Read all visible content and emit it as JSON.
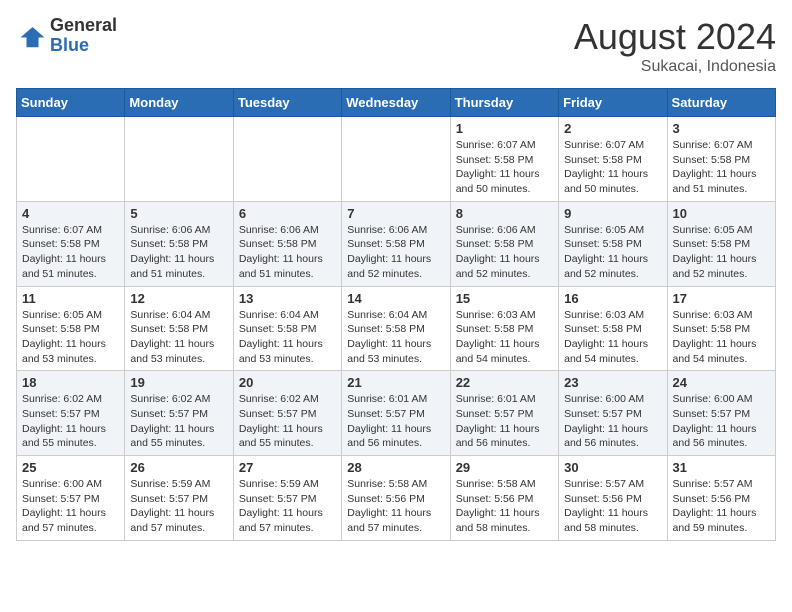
{
  "logo": {
    "general": "General",
    "blue": "Blue"
  },
  "title": {
    "month_year": "August 2024",
    "location": "Sukacai, Indonesia"
  },
  "weekdays": [
    "Sunday",
    "Monday",
    "Tuesday",
    "Wednesday",
    "Thursday",
    "Friday",
    "Saturday"
  ],
  "weeks": [
    [
      {
        "day": "",
        "info": ""
      },
      {
        "day": "",
        "info": ""
      },
      {
        "day": "",
        "info": ""
      },
      {
        "day": "",
        "info": ""
      },
      {
        "day": "1",
        "info": "Sunrise: 6:07 AM\nSunset: 5:58 PM\nDaylight: 11 hours\nand 50 minutes."
      },
      {
        "day": "2",
        "info": "Sunrise: 6:07 AM\nSunset: 5:58 PM\nDaylight: 11 hours\nand 50 minutes."
      },
      {
        "day": "3",
        "info": "Sunrise: 6:07 AM\nSunset: 5:58 PM\nDaylight: 11 hours\nand 51 minutes."
      }
    ],
    [
      {
        "day": "4",
        "info": "Sunrise: 6:07 AM\nSunset: 5:58 PM\nDaylight: 11 hours\nand 51 minutes."
      },
      {
        "day": "5",
        "info": "Sunrise: 6:06 AM\nSunset: 5:58 PM\nDaylight: 11 hours\nand 51 minutes."
      },
      {
        "day": "6",
        "info": "Sunrise: 6:06 AM\nSunset: 5:58 PM\nDaylight: 11 hours\nand 51 minutes."
      },
      {
        "day": "7",
        "info": "Sunrise: 6:06 AM\nSunset: 5:58 PM\nDaylight: 11 hours\nand 52 minutes."
      },
      {
        "day": "8",
        "info": "Sunrise: 6:06 AM\nSunset: 5:58 PM\nDaylight: 11 hours\nand 52 minutes."
      },
      {
        "day": "9",
        "info": "Sunrise: 6:05 AM\nSunset: 5:58 PM\nDaylight: 11 hours\nand 52 minutes."
      },
      {
        "day": "10",
        "info": "Sunrise: 6:05 AM\nSunset: 5:58 PM\nDaylight: 11 hours\nand 52 minutes."
      }
    ],
    [
      {
        "day": "11",
        "info": "Sunrise: 6:05 AM\nSunset: 5:58 PM\nDaylight: 11 hours\nand 53 minutes."
      },
      {
        "day": "12",
        "info": "Sunrise: 6:04 AM\nSunset: 5:58 PM\nDaylight: 11 hours\nand 53 minutes."
      },
      {
        "day": "13",
        "info": "Sunrise: 6:04 AM\nSunset: 5:58 PM\nDaylight: 11 hours\nand 53 minutes."
      },
      {
        "day": "14",
        "info": "Sunrise: 6:04 AM\nSunset: 5:58 PM\nDaylight: 11 hours\nand 53 minutes."
      },
      {
        "day": "15",
        "info": "Sunrise: 6:03 AM\nSunset: 5:58 PM\nDaylight: 11 hours\nand 54 minutes."
      },
      {
        "day": "16",
        "info": "Sunrise: 6:03 AM\nSunset: 5:58 PM\nDaylight: 11 hours\nand 54 minutes."
      },
      {
        "day": "17",
        "info": "Sunrise: 6:03 AM\nSunset: 5:58 PM\nDaylight: 11 hours\nand 54 minutes."
      }
    ],
    [
      {
        "day": "18",
        "info": "Sunrise: 6:02 AM\nSunset: 5:57 PM\nDaylight: 11 hours\nand 55 minutes."
      },
      {
        "day": "19",
        "info": "Sunrise: 6:02 AM\nSunset: 5:57 PM\nDaylight: 11 hours\nand 55 minutes."
      },
      {
        "day": "20",
        "info": "Sunrise: 6:02 AM\nSunset: 5:57 PM\nDaylight: 11 hours\nand 55 minutes."
      },
      {
        "day": "21",
        "info": "Sunrise: 6:01 AM\nSunset: 5:57 PM\nDaylight: 11 hours\nand 56 minutes."
      },
      {
        "day": "22",
        "info": "Sunrise: 6:01 AM\nSunset: 5:57 PM\nDaylight: 11 hours\nand 56 minutes."
      },
      {
        "day": "23",
        "info": "Sunrise: 6:00 AM\nSunset: 5:57 PM\nDaylight: 11 hours\nand 56 minutes."
      },
      {
        "day": "24",
        "info": "Sunrise: 6:00 AM\nSunset: 5:57 PM\nDaylight: 11 hours\nand 56 minutes."
      }
    ],
    [
      {
        "day": "25",
        "info": "Sunrise: 6:00 AM\nSunset: 5:57 PM\nDaylight: 11 hours\nand 57 minutes."
      },
      {
        "day": "26",
        "info": "Sunrise: 5:59 AM\nSunset: 5:57 PM\nDaylight: 11 hours\nand 57 minutes."
      },
      {
        "day": "27",
        "info": "Sunrise: 5:59 AM\nSunset: 5:57 PM\nDaylight: 11 hours\nand 57 minutes."
      },
      {
        "day": "28",
        "info": "Sunrise: 5:58 AM\nSunset: 5:56 PM\nDaylight: 11 hours\nand 57 minutes."
      },
      {
        "day": "29",
        "info": "Sunrise: 5:58 AM\nSunset: 5:56 PM\nDaylight: 11 hours\nand 58 minutes."
      },
      {
        "day": "30",
        "info": "Sunrise: 5:57 AM\nSunset: 5:56 PM\nDaylight: 11 hours\nand 58 minutes."
      },
      {
        "day": "31",
        "info": "Sunrise: 5:57 AM\nSunset: 5:56 PM\nDaylight: 11 hours\nand 59 minutes."
      }
    ]
  ]
}
